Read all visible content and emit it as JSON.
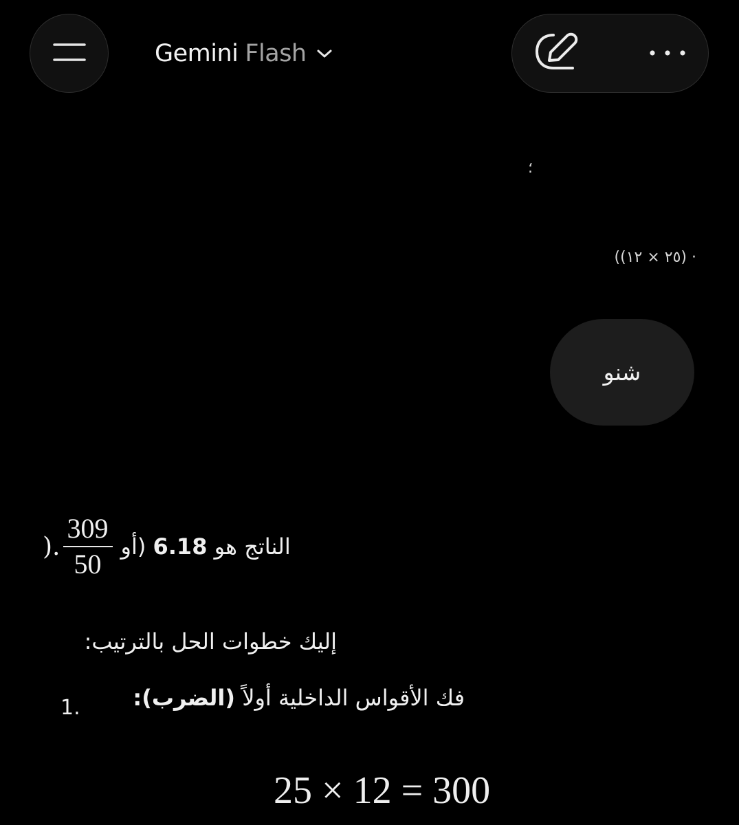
{
  "header": {
    "menu_icon": "hamburger-menu-icon",
    "model_name": "Gemini",
    "model_tier": "Flash",
    "dropdown_icon": "chevron-down-icon",
    "new_chat_icon": "edit-pencil-icon",
    "more_icon": "more-horizontal-icon"
  },
  "conversation": {
    "fragment_top": "؛",
    "fragment_expression": "((٢٥ × ١٢) ·",
    "user_message": "شنو",
    "response": {
      "result_prefix": "الناتج هو ",
      "result_value": "6.18",
      "result_or": " (أو ",
      "fraction_numerator": "309",
      "fraction_denominator": "50",
      "close_paren": ").",
      "steps_intro": "إليك خطوات الحل بالترتيب:",
      "step_1_number": "1.",
      "step_1_text": "فك الأقواس الداخلية أولاً ",
      "step_1_bold": "(الضرب):",
      "equation": "25 × 12 = 300"
    }
  },
  "colors": {
    "background": "#000000",
    "surface": "#111111",
    "bubble": "#1d1d1d",
    "text": "#f0f0f0",
    "muted": "#a4a4a4"
  }
}
